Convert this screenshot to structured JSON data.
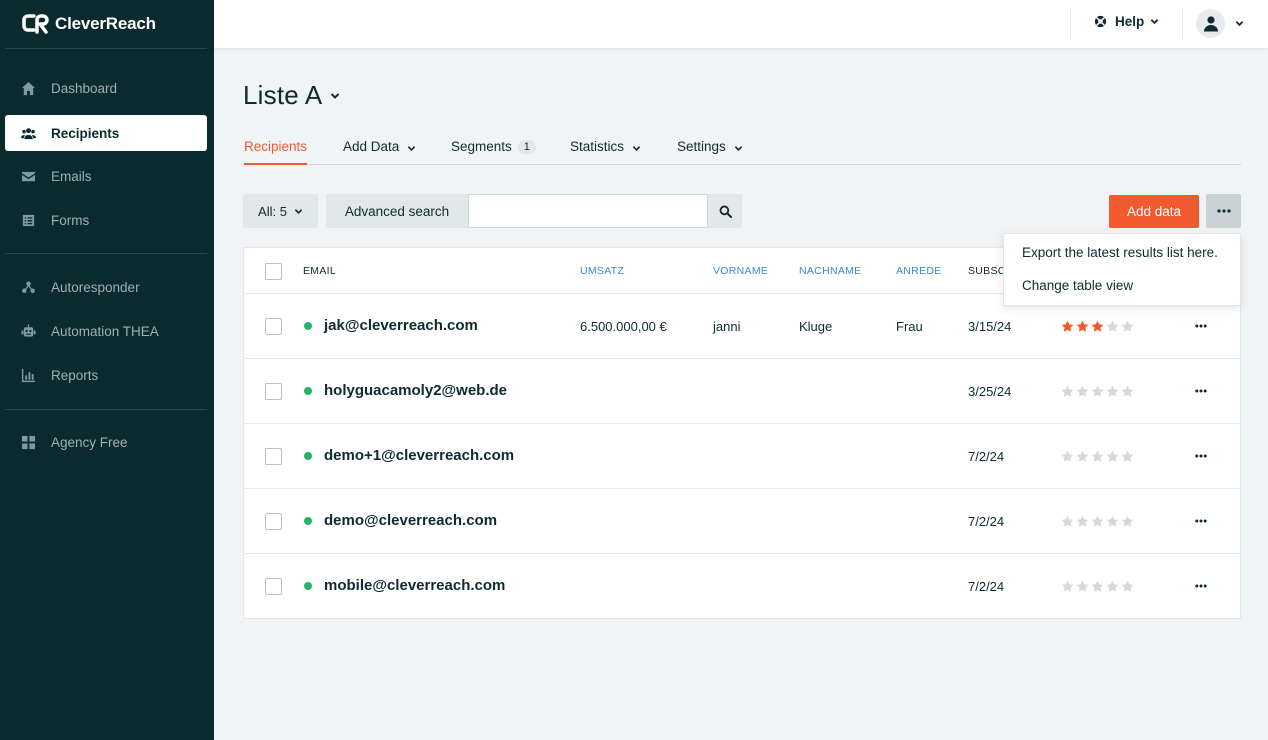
{
  "brand": {
    "name": "CleverReach",
    "accent": "#f05a2e",
    "sidebar_bg": "#0b2a2e",
    "link_color": "#3a8ad1",
    "status_active": "#23b36a"
  },
  "sidebar": {
    "items": [
      {
        "label": "Dashboard",
        "icon": "home-icon"
      },
      {
        "label": "Recipients",
        "icon": "users-icon",
        "active": true
      },
      {
        "label": "Emails",
        "icon": "envelope-icon"
      },
      {
        "label": "Forms",
        "icon": "form-icon"
      },
      {
        "label": "Autoresponder",
        "icon": "autoresponder-icon"
      },
      {
        "label": "Automation THEA",
        "icon": "robot-icon"
      },
      {
        "label": "Reports",
        "icon": "chart-icon"
      },
      {
        "label": "Agency Free",
        "icon": "grid-icon"
      }
    ]
  },
  "topbar": {
    "help_label": "Help"
  },
  "page": {
    "title": "Liste A",
    "tabs": [
      {
        "label": "Recipients",
        "active": true
      },
      {
        "label": "Add Data",
        "dropdown": true
      },
      {
        "label": "Segments",
        "badge": "1"
      },
      {
        "label": "Statistics",
        "dropdown": true
      },
      {
        "label": "Settings",
        "dropdown": true
      }
    ]
  },
  "toolbar": {
    "filter_label": "All: 5",
    "advanced_search_label": "Advanced search",
    "search_value": "",
    "add_data_label": "Add data"
  },
  "more_menu": {
    "items": [
      "Export the latest results list here.",
      "Change table view"
    ]
  },
  "table": {
    "columns": [
      "EMAIL",
      "UMSATZ",
      "VORNAME",
      "NACHNAME",
      "ANREDE",
      "SUBSC"
    ],
    "rows": [
      {
        "email": "jak@cleverreach.com",
        "umsatz": "6.500.000,00 €",
        "vorname": "janni",
        "nachname": "Kluge",
        "anrede": "Frau",
        "subscribed": "3/15/24",
        "rating": 3
      },
      {
        "email": "holyguacamoly2@web.de",
        "umsatz": "",
        "vorname": "",
        "nachname": "",
        "anrede": "",
        "subscribed": "3/25/24",
        "rating": 0
      },
      {
        "email": "demo+1@cleverreach.com",
        "umsatz": "",
        "vorname": "",
        "nachname": "",
        "anrede": "",
        "subscribed": "7/2/24",
        "rating": 0
      },
      {
        "email": "demo@cleverreach.com",
        "umsatz": "",
        "vorname": "",
        "nachname": "",
        "anrede": "",
        "subscribed": "7/2/24",
        "rating": 0
      },
      {
        "email": "mobile@cleverreach.com",
        "umsatz": "",
        "vorname": "",
        "nachname": "",
        "anrede": "",
        "subscribed": "7/2/24",
        "rating": 0
      }
    ]
  }
}
